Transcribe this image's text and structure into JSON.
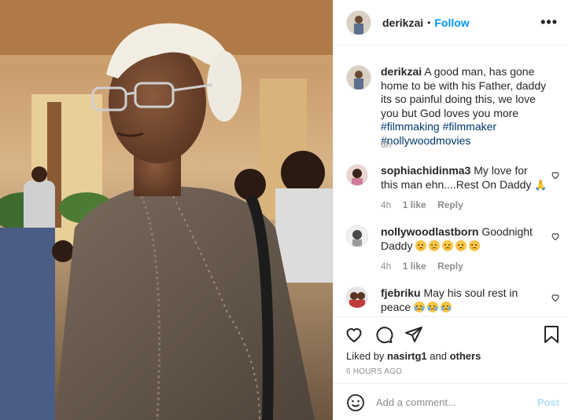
{
  "post": {
    "username": "derikzai",
    "separator": "•",
    "follow_label": "Follow",
    "more_label": "•••",
    "photo_alt": "Photo of an elderly man with white hair and glasses wearing a grey traditional outfit"
  },
  "caption": {
    "username": "derikzai",
    "text": "A good man, has gone home to be with his Father, daddy its so painful doing this, we love you but God loves you more",
    "tags": [
      "#filmmaking",
      "#filmmaker",
      "#nollywoodmovies"
    ],
    "time": "6h"
  },
  "comments": [
    {
      "username": "sophiachidinma3",
      "text": "My love for this man ehn....Rest On Daddy",
      "emoji": [
        "folded-hands"
      ],
      "time": "4h",
      "likes": "1 like",
      "reply": "Reply"
    },
    {
      "username": "nollywoodlastborn",
      "text": "Goodnight Daddy",
      "emoji": [
        "sad",
        "sad",
        "sad",
        "sad",
        "sad"
      ],
      "time": "4h",
      "likes": "1 like",
      "reply": "Reply"
    },
    {
      "username": "fjebriku",
      "text": "May his soul rest in peace",
      "emoji": [
        "crying",
        "crying",
        "crying"
      ]
    }
  ],
  "actions": {
    "liked_by_prefix": "Liked by",
    "liked_by_user": "nasirtg1",
    "liked_by_and": "and",
    "liked_by_others": "others",
    "time_ago": "6 HOURS AGO"
  },
  "composer": {
    "placeholder": "Add a comment...",
    "post_label": "Post"
  },
  "icons": {
    "like": "heart-icon",
    "comment": "comment-icon",
    "share": "paper-plane-icon",
    "save": "bookmark-icon",
    "emoji": "smiley-icon"
  },
  "colors": {
    "link_blue": "#0095f6",
    "hashtag": "#00376b",
    "muted": "#8e8e8e",
    "post_disabled": "#b2dffc"
  }
}
